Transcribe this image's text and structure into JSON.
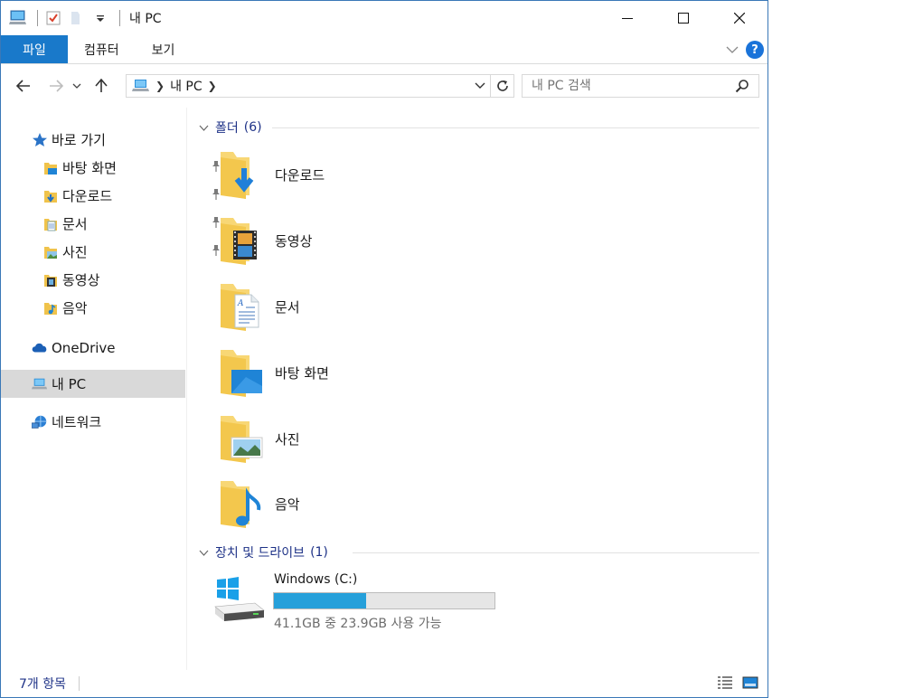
{
  "window": {
    "title": "내 PC"
  },
  "ribbon": {
    "tabs": [
      "파일",
      "컴퓨터",
      "보기"
    ],
    "help_label": "?"
  },
  "navigation": {
    "address": {
      "root_label": "내 PC"
    },
    "search": {
      "placeholder": "내 PC 검색"
    }
  },
  "sidebar": {
    "quick_access_label": "바로 가기",
    "quick_items": [
      {
        "label": "바탕 화면",
        "icon": "desktop-folder-icon",
        "pinned": true
      },
      {
        "label": "다운로드",
        "icon": "downloads-folder-icon",
        "pinned": true
      },
      {
        "label": "문서",
        "icon": "documents-folder-icon",
        "pinned": true
      },
      {
        "label": "사진",
        "icon": "pictures-folder-icon",
        "pinned": true
      },
      {
        "label": "동영상",
        "icon": "videos-folder-icon",
        "pinned": false
      },
      {
        "label": "음악",
        "icon": "music-folder-icon",
        "pinned": false
      }
    ],
    "onedrive_label": "OneDrive",
    "thispc_label": "내 PC",
    "network_label": "네트워크"
  },
  "content": {
    "folders_group": {
      "label": "폴더",
      "count": "(6)"
    },
    "folders": [
      {
        "name": "다운로드",
        "icon": "downloads-folder-icon"
      },
      {
        "name": "동영상",
        "icon": "videos-folder-icon"
      },
      {
        "name": "문서",
        "icon": "documents-folder-icon"
      },
      {
        "name": "바탕 화면",
        "icon": "desktop-folder-icon"
      },
      {
        "name": "사진",
        "icon": "pictures-folder-icon"
      },
      {
        "name": "음악",
        "icon": "music-folder-icon"
      }
    ],
    "devices_group": {
      "label": "장치 및 드라이브",
      "count": "(1)"
    },
    "drives": [
      {
        "name": "Windows (C:)",
        "used_fraction": 0.42,
        "size_text": "41.1GB 중 23.9GB 사용 가능"
      }
    ]
  },
  "status": {
    "item_count": "7개 항목"
  },
  "colors": {
    "accent": "#1979ca",
    "drive_fill": "#26a0da",
    "group_header": "#1e3287"
  }
}
